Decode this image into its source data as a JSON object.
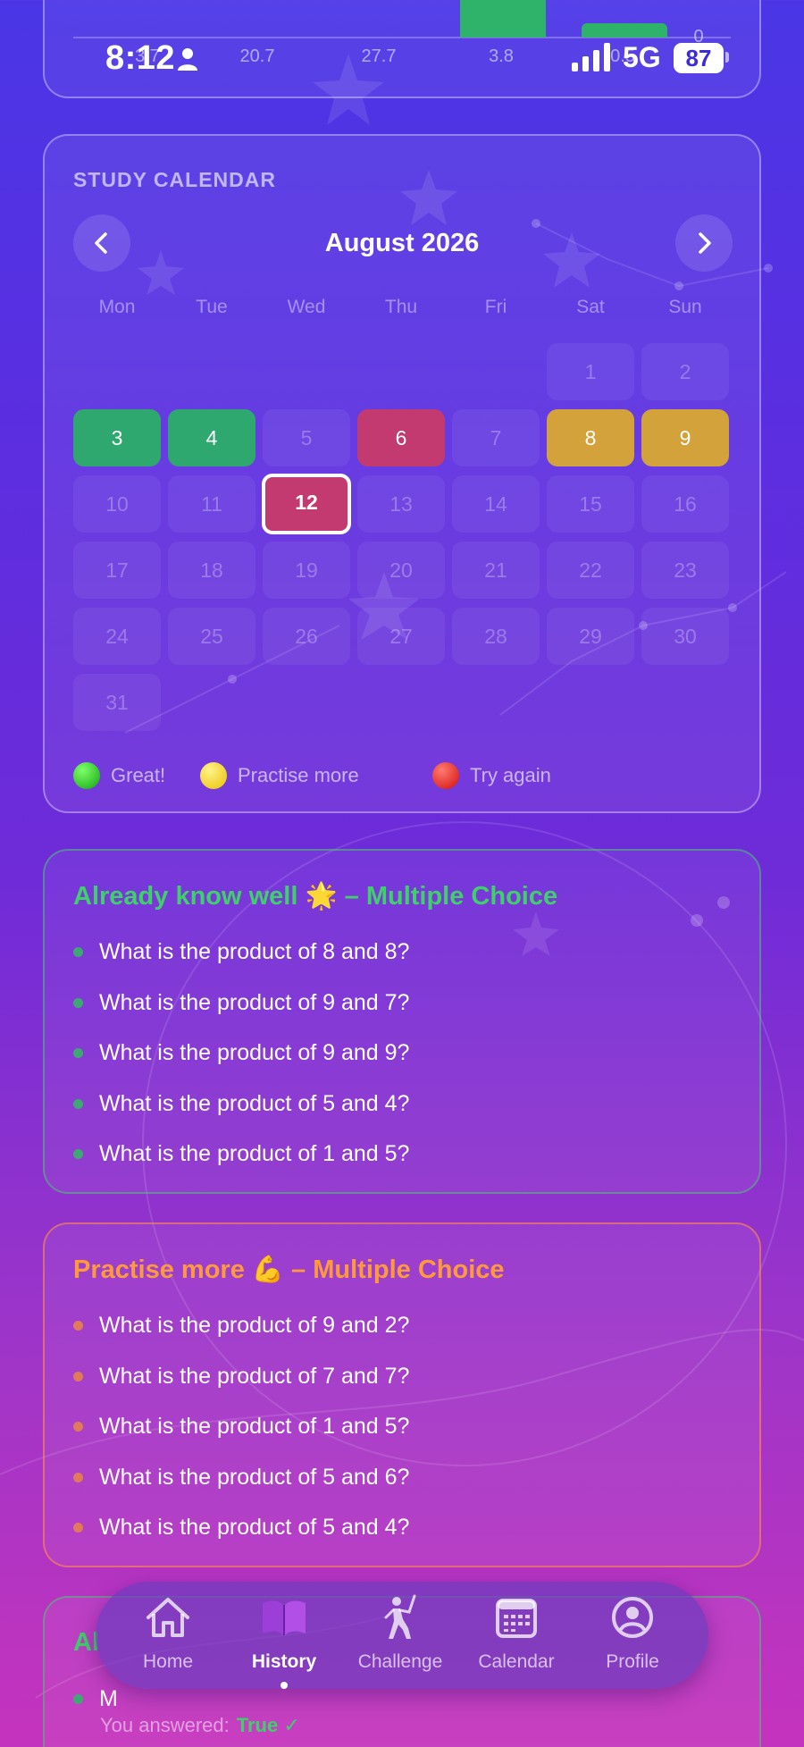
{
  "status_bar": {
    "time": "8:12",
    "network": "5G",
    "battery": "87"
  },
  "chart_fragment": {
    "values": [
      "3.7",
      "20.7",
      "27.7",
      "3.8",
      "0.5"
    ],
    "top_value": "0"
  },
  "calendar": {
    "title": "STUDY CALENDAR",
    "month": "August 2026",
    "weekdays": [
      "Mon",
      "Tue",
      "Wed",
      "Thu",
      "Fri",
      "Sat",
      "Sun"
    ],
    "days": [
      {
        "d": "1",
        "status": "none"
      },
      {
        "d": "2",
        "status": "none"
      },
      {
        "d": "3",
        "status": "green"
      },
      {
        "d": "4",
        "status": "green"
      },
      {
        "d": "5",
        "status": "empty"
      },
      {
        "d": "6",
        "status": "red"
      },
      {
        "d": "7",
        "status": "empty"
      },
      {
        "d": "8",
        "status": "yellow"
      },
      {
        "d": "9",
        "status": "yellow"
      },
      {
        "d": "10",
        "status": "none"
      },
      {
        "d": "11",
        "status": "none"
      },
      {
        "d": "12",
        "status": "today"
      },
      {
        "d": "13",
        "status": "none"
      },
      {
        "d": "14",
        "status": "none"
      },
      {
        "d": "15",
        "status": "none"
      },
      {
        "d": "16",
        "status": "none"
      },
      {
        "d": "17",
        "status": "none"
      },
      {
        "d": "18",
        "status": "none"
      },
      {
        "d": "19",
        "status": "none"
      },
      {
        "d": "20",
        "status": "none"
      },
      {
        "d": "21",
        "status": "none"
      },
      {
        "d": "22",
        "status": "none"
      },
      {
        "d": "23",
        "status": "none"
      },
      {
        "d": "24",
        "status": "none"
      },
      {
        "d": "25",
        "status": "none"
      },
      {
        "d": "26",
        "status": "none"
      },
      {
        "d": "27",
        "status": "none"
      },
      {
        "d": "28",
        "status": "none"
      },
      {
        "d": "29",
        "status": "none"
      },
      {
        "d": "30",
        "status": "none"
      },
      {
        "d": "31",
        "status": "none"
      }
    ],
    "legend": [
      {
        "label": "Great!",
        "color": "#22c21a"
      },
      {
        "label": "Practise more",
        "color": "#f5d20a"
      },
      {
        "label": "Try again",
        "color": "#e01818"
      }
    ]
  },
  "sections": [
    {
      "title": "Already know well 🌟 – Multiple Choice",
      "items": [
        "What is the product of 8 and 8?",
        "What is the product of 9 and 7?",
        "What is the product of 9 and 9?",
        "What is the product of 5 and 4?",
        "What is the product of 1 and 5?"
      ]
    },
    {
      "title": "Practise more 💪 – Multiple Choice",
      "items": [
        "What is the product of 9 and 2?",
        "What is the product of 7 and 7?",
        "What is the product of 1 and 5?",
        "What is the product of 5 and 6?",
        "What is the product of 5 and 4?"
      ]
    },
    {
      "title": "Al",
      "items": [
        "M"
      ],
      "answered_label": "You answered:",
      "answered_value": "True ✓"
    }
  ],
  "tabs": [
    {
      "label": "Home",
      "icon": "home-icon"
    },
    {
      "label": "History",
      "icon": "book-icon",
      "active": true
    },
    {
      "label": "Challenge",
      "icon": "fencer-icon"
    },
    {
      "label": "Calendar",
      "icon": "calendar-icon"
    },
    {
      "label": "Profile",
      "icon": "profile-icon"
    }
  ]
}
